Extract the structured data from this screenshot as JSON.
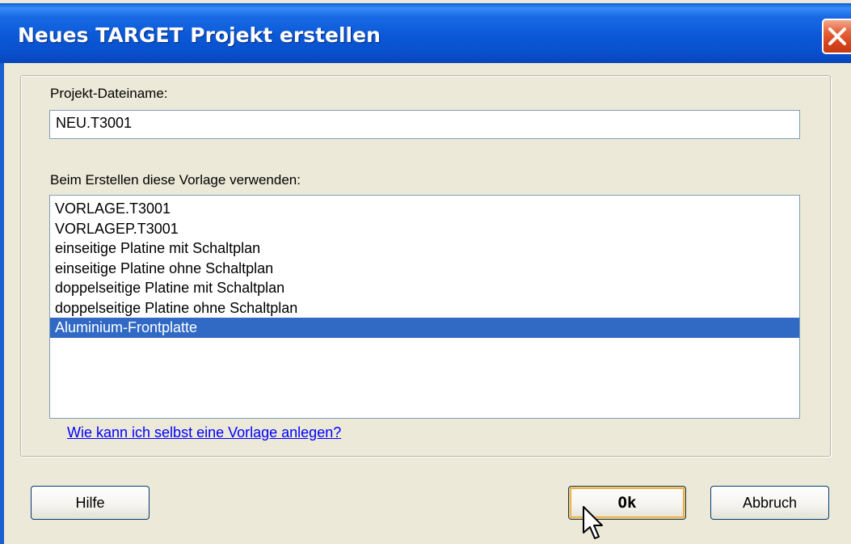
{
  "window": {
    "title": "Neues TARGET Projekt erstellen",
    "close_icon": "close-icon"
  },
  "form": {
    "filename_label": "Projekt-Dateiname:",
    "filename_value": "NEU.T3001",
    "template_label": "Beim Erstellen diese Vorlage verwenden:",
    "templates": [
      "VORLAGE.T3001",
      "VORLAGEP.T3001",
      "einseitige Platine mit Schaltplan",
      "einseitige Platine ohne Schaltplan",
      "doppelseitige Platine mit Schaltplan",
      "doppelseitige Platine ohne Schaltplan",
      "Aluminium-Frontplatte"
    ],
    "selected_template": "Aluminium-Frontplatte",
    "help_link": "Wie kann ich selbst eine Vorlage anlegen?"
  },
  "buttons": {
    "help": "Hilfe",
    "ok": "Ok",
    "cancel": "Abbruch"
  },
  "colors": {
    "titlebar": "#0a58d6",
    "dialog_bg": "#ece9d8",
    "selection": "#316ac5",
    "link": "#0000ff",
    "close_button": "#d6451c"
  }
}
